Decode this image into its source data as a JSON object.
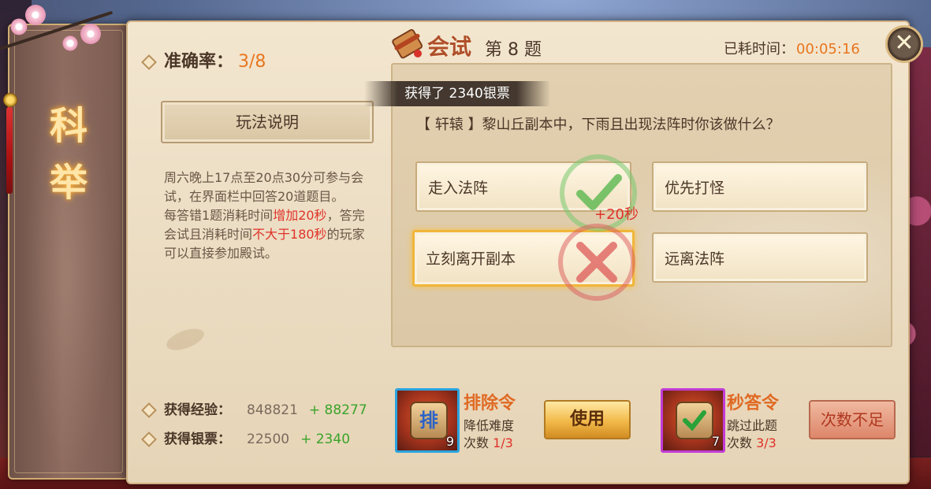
{
  "banner": {
    "char1": "科",
    "char2": "举"
  },
  "stats": {
    "accuracy_label": "准确率：",
    "accuracy_value": "3/8",
    "exp_label": "获得经验：",
    "exp_value": "848821",
    "exp_gain": "+ 88277",
    "silver_label": "获得银票：",
    "silver_value": "22500",
    "silver_gain": "+ 2340"
  },
  "rules": {
    "button_label": "玩法说明",
    "line1": "周六晚上17点至20点30分可参与会试，在界面栏中回答20道题目。",
    "line2_a": "每答错1题消耗时间",
    "line2_b": "增加20秒",
    "line2_c": "，答完会试且消耗时间",
    "line2_d": "不大于180秒",
    "line2_e": "的玩家可以直接参加殿试。"
  },
  "header": {
    "title": "会试",
    "question_number": "第 8 题",
    "timer_label": "已耗时间：",
    "timer_value": "00:05:16"
  },
  "toast": "获得了 2340银票",
  "question": "【 轩辕 】黎山丘副本中，下雨且出现法阵时你该做什么？",
  "answers": [
    {
      "label": "走入法阵"
    },
    {
      "label": "优先打怪"
    },
    {
      "label": "立刻离开副本"
    },
    {
      "label": "远离法阵"
    }
  ],
  "penalty": "+20秒",
  "items": [
    {
      "name": "排除令",
      "glyph": "排",
      "count": "9",
      "desc": "降低难度",
      "uses_label": "次数",
      "uses_value": "1/3",
      "action": "使用",
      "color": "#2aa4e0"
    },
    {
      "name": "秒答令",
      "count": "7",
      "desc": "跳过此题",
      "uses_label": "次数",
      "uses_value": "3/3",
      "action": "次数不足",
      "color": "#c23bd6"
    }
  ]
}
